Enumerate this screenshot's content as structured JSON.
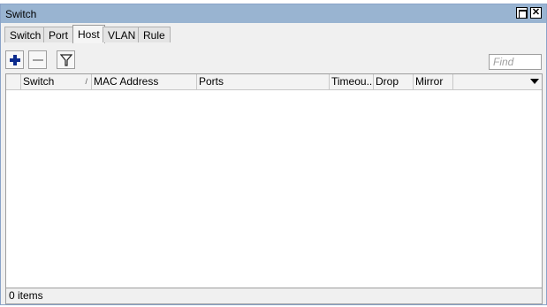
{
  "window": {
    "title": "Switch"
  },
  "tabs": [
    {
      "label": "Switch"
    },
    {
      "label": "Port"
    },
    {
      "label": "Host",
      "active": true
    },
    {
      "label": "VLAN"
    },
    {
      "label": "Rule"
    }
  ],
  "toolbar": {
    "add_icon": "plus-icon",
    "remove_icon": "minus-icon",
    "filter_icon": "filter-icon",
    "find_placeholder": "Find"
  },
  "table": {
    "columns": [
      "Switch",
      "MAC Address",
      "Ports",
      "Timeou...",
      "Drop",
      "Mirror"
    ],
    "sort_indicator": "/",
    "rows": []
  },
  "status": {
    "text": "0 items"
  },
  "colors": {
    "titlebar": "#99b4d1",
    "add_icon": "#0a2a8c"
  }
}
